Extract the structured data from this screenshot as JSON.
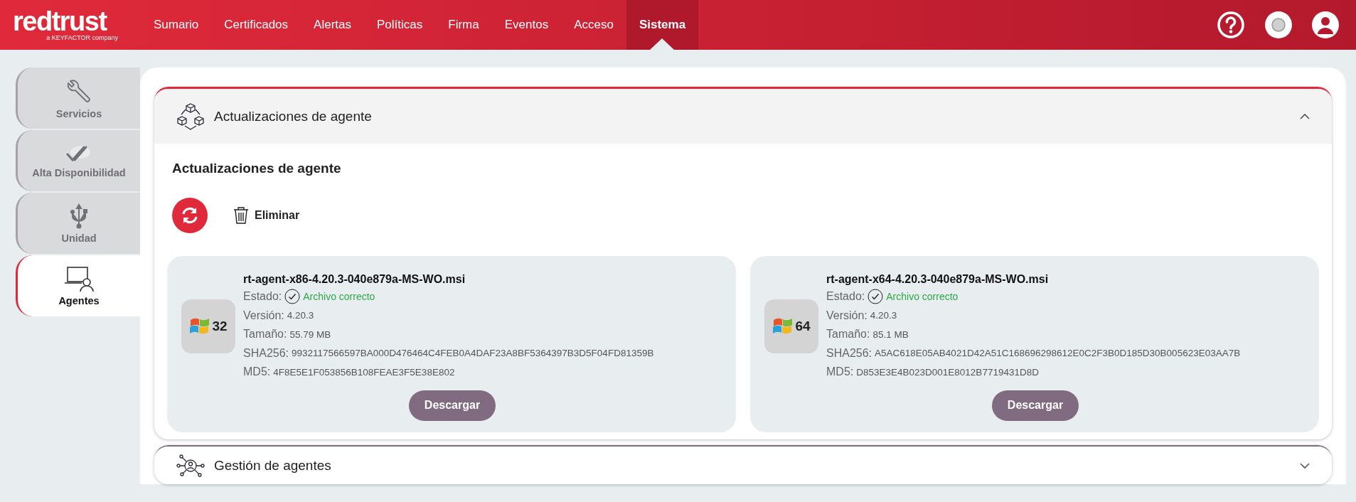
{
  "header": {
    "logo": "redtrust",
    "logo_tagline": "a KEYFACTOR company",
    "nav": [
      {
        "label": "Sumario",
        "selected": false
      },
      {
        "label": "Certificados",
        "selected": false
      },
      {
        "label": "Alertas",
        "selected": false
      },
      {
        "label": "Políticas",
        "selected": false
      },
      {
        "label": "Firma",
        "selected": false
      },
      {
        "label": "Eventos",
        "selected": false
      },
      {
        "label": "Acceso",
        "selected": false
      },
      {
        "label": "Sistema",
        "selected": true
      }
    ]
  },
  "sidebar": {
    "items": [
      {
        "label": "Servicios",
        "selected": false
      },
      {
        "label": "Alta Disponibilidad",
        "selected": false
      },
      {
        "label": "Unidad",
        "selected": false
      },
      {
        "label": "Agentes",
        "selected": true
      }
    ]
  },
  "sections": [
    {
      "title": "Actualizaciones de agente",
      "expanded": true,
      "heading": "Actualizaciones de agente",
      "delete_label": "Eliminar",
      "agents": [
        {
          "badge": "32",
          "filename": "rt-agent-x86-4.20.3-040e879a-MS-WO.msi",
          "status_label": "Estado:",
          "status": "Archivo correcto",
          "fields": [
            {
              "label": "Versión:",
              "value": "4.20.3"
            },
            {
              "label": "Tamaño:",
              "value": "55.79 MB"
            },
            {
              "label": "SHA256:",
              "value": "9932117566597BA000D476464C4FEB0A4DAF23A8BF5364397B3D5F04FD81359B"
            },
            {
              "label": "MD5:",
              "value": "4F8E5E1F053856B108FEAE3F5E38E802"
            }
          ],
          "button": "Descargar"
        },
        {
          "badge": "64",
          "filename": "rt-agent-x64-4.20.3-040e879a-MS-WO.msi",
          "status_label": "Estado:",
          "status": "Archivo correcto",
          "fields": [
            {
              "label": "Versión:",
              "value": "4.20.3"
            },
            {
              "label": "Tamaño:",
              "value": "85.1 MB"
            },
            {
              "label": "SHA256:",
              "value": "A5AC618E05AB4021D42A51C168696298612E0C2F3B0D185D30B005623E03AA7B"
            },
            {
              "label": "MD5:",
              "value": "D853E3E4B023D001E8012B7719431D8D"
            }
          ],
          "button": "Descargar"
        }
      ]
    },
    {
      "title": "Gestión de agentes",
      "expanded": false
    }
  ]
}
